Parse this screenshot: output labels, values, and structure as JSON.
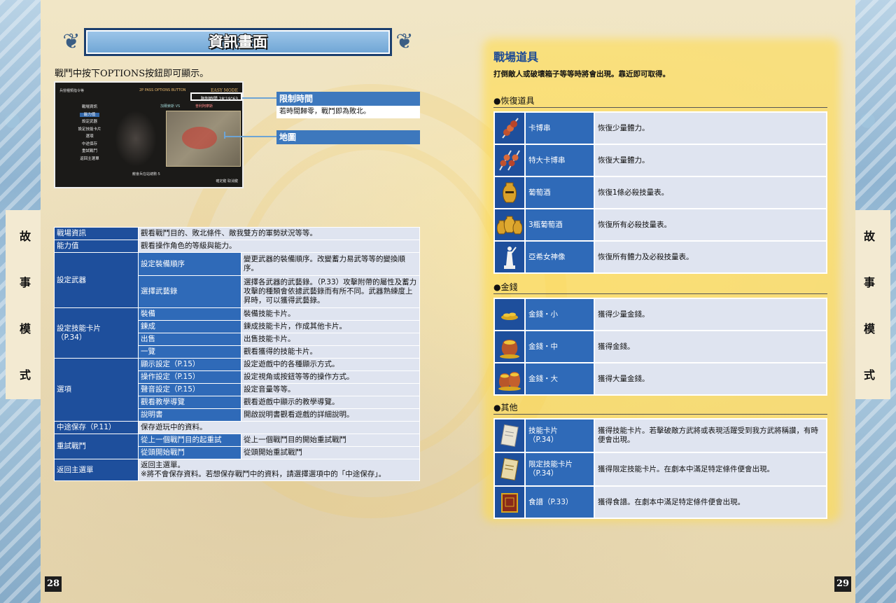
{
  "left_page": {
    "title": "資訊畫面",
    "intro": "戰鬥中按下OPTIONS按鈕即可顯示。",
    "side_label": [
      "故",
      "事",
      "模",
      "式"
    ],
    "page_number": "28",
    "screenshot": {
      "header": "兵營種類指令等",
      "header2": "2P PASS OPTIONS BUTTON",
      "mode": "EASY MODE",
      "timer": "限制時間 28'19\"63",
      "menu": [
        "戰場資訊",
        "能力值",
        "設定武器",
        "設定技能卡片",
        "選項",
        "中途保存",
        "重試戰鬥",
        "返回主選單"
      ],
      "vs_left": "加爾索斯",
      "vs_mid": "VS",
      "vs_right": "普利阿摩斯",
      "footer": "敵會兵在站總數·5",
      "footer2": "確定鍵  取消鍵"
    },
    "callouts": [
      {
        "label": "限制時間",
        "desc": "若時間歸零，戰鬥即為敗北。"
      },
      {
        "label": "地圖",
        "desc": ""
      }
    ],
    "table": [
      {
        "cat": "戰場資訊",
        "desc": "觀看戰鬥目的、敗北條件、敵我雙方的軍勢狀況等等。"
      },
      {
        "cat": "能力值",
        "desc": "觀看操作角色的等級與能力。"
      },
      {
        "cat": "設定武器",
        "subs": [
          {
            "name": "設定裝備順序",
            "desc": "變更武器的裝備順序。改變蓄力易武等等的變換順序。"
          },
          {
            "name": "選擇武藝錄",
            "desc": "選擇各武器的武藝錄。（P.33）攻擊附帶的屬性及蓄力攻擊的種類會依據武藝錄而有所不同。武器熟練度上昇時，可以獲得武藝錄。"
          }
        ]
      },
      {
        "cat": "設定技能卡片\n（P.34）",
        "subs": [
          {
            "name": "裝備",
            "desc": "裝備技能卡片。"
          },
          {
            "name": "鍊成",
            "desc": "鍊成技能卡片，作成其他卡片。"
          },
          {
            "name": "出售",
            "desc": "出售技能卡片。"
          },
          {
            "name": "一覽",
            "desc": "觀看獲得的技能卡片。"
          }
        ]
      },
      {
        "cat": "選項",
        "subs": [
          {
            "name": "顯示設定（P.15）",
            "desc": "設定遊戲中的各種顯示方式。"
          },
          {
            "name": "操作設定（P.15）",
            "desc": "設定視角或按鈕等等的操作方式。"
          },
          {
            "name": "聲音設定（P.15）",
            "desc": "設定音量等等。"
          },
          {
            "name": "觀看教學導覽",
            "desc": "觀看遊戲中顯示的教學導覽。"
          },
          {
            "name": "說明書",
            "desc": "開啟說明書觀看遊戲的詳細說明。"
          }
        ]
      },
      {
        "cat": "中途保存（P.11）",
        "desc": "保存遊玩中的資料。"
      },
      {
        "cat": "重試戰鬥",
        "subs": [
          {
            "name": "從上一個戰鬥目的起重試",
            "desc": "從上一個戰鬥目的開始重試戰鬥"
          },
          {
            "name": "從頭開始戰鬥",
            "desc": "從頭開始重試戰鬥"
          }
        ]
      },
      {
        "cat": "返回主選單",
        "desc": "返回主選單。\n※將不會保存資料。若想保存戰鬥中的資料，請選擇選項中的「中途保存」。"
      }
    ]
  },
  "right_page": {
    "title": "戰場道具",
    "subtitle": "打倒敵人或破壞箱子等等時將會出現。靠近即可取得。",
    "side_label": [
      "故",
      "事",
      "模",
      "式"
    ],
    "page_number": "29",
    "sections": [
      {
        "heading": "●恢復道具",
        "items": [
          {
            "icon": "kebab-icon",
            "name": "卡博串",
            "desc": "恢復少量體力。"
          },
          {
            "icon": "big-kebab-icon",
            "name": "特大卡博串",
            "desc": "恢復大量體力。"
          },
          {
            "icon": "wine-amphora-icon",
            "name": "葡萄酒",
            "desc": "恢復1條必殺技量表。"
          },
          {
            "icon": "three-amphora-icon",
            "name": "3瓶葡萄酒",
            "desc": "恢復所有必殺技量表。"
          },
          {
            "icon": "goddess-statue-icon",
            "name": "亞希女神像",
            "desc": "恢復所有體力及必殺技量表。"
          }
        ]
      },
      {
        "heading": "●金錢",
        "items": [
          {
            "icon": "coins-small-icon",
            "name": "金錢・小",
            "desc": "獲得少量金錢。"
          },
          {
            "icon": "coins-medium-icon",
            "name": "金錢・中",
            "desc": "獲得金錢。"
          },
          {
            "icon": "coins-large-icon",
            "name": "金錢・大",
            "desc": "獲得大量金錢。"
          }
        ]
      },
      {
        "heading": "●其他",
        "items": [
          {
            "icon": "skill-card-icon",
            "name": "技能卡片\n（P.34）",
            "desc": "獲得技能卡片。若擊破敵方武將或表現活躍受到我方武將稱讚，有時便會出現。"
          },
          {
            "icon": "limited-card-icon",
            "name": "限定技能卡片\n（P.34）",
            "desc": "獲得限定技能卡片。在劇本中滿足特定條件便會出現。"
          },
          {
            "icon": "recipe-book-icon",
            "name": "食譜（P.33）",
            "desc": "獲得食譜。在劇本中滿足特定條件便會出現。"
          }
        ]
      }
    ]
  },
  "colors": {
    "header_dark": "#1e4f9c",
    "header_mid": "#2f6ab8",
    "cell_light": "#dfe4f0",
    "title_blue": "#1d4b95"
  }
}
